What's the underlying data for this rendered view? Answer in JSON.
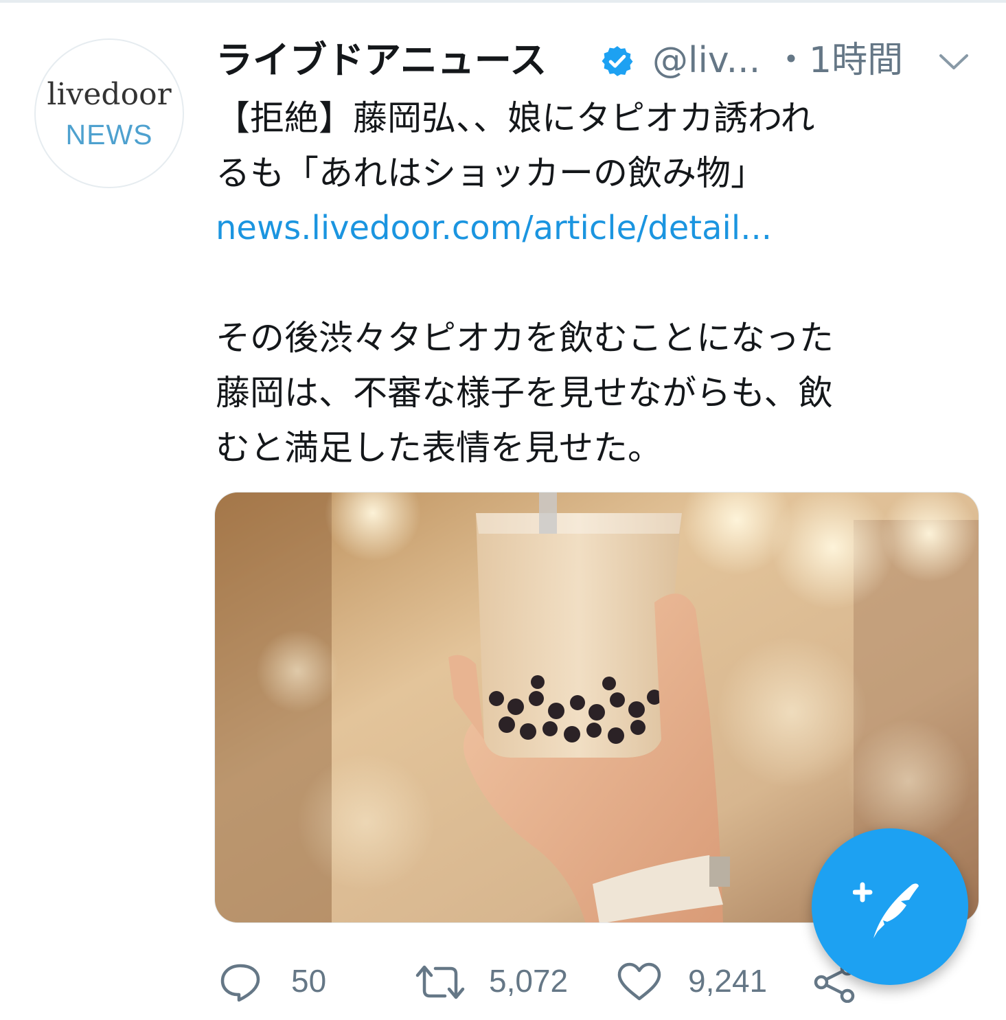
{
  "tweet": {
    "avatar": {
      "brand_top": "livedoor",
      "brand_bottom": "NEWS"
    },
    "display_name": "ライブドアニュース",
    "handle": "@liv...",
    "time": "・1時間",
    "verified": true,
    "lines": [
      "【拒絶】藤岡弘、、娘にタピオカ誘われ",
      "るも「あれはショッカーの飲み物」"
    ],
    "link": "news.livedoor.com/article/detail...",
    "body_lines": [
      "その後渋々タピオカを飲むことになった",
      "藤岡は、不審な様子を見せながらも、飲",
      "むと満足した表情を見せた。"
    ],
    "actions": {
      "reply_count": "50",
      "retweet_count": "5,072",
      "like_count": "9,241"
    }
  },
  "colors": {
    "accent": "#1da1f2",
    "link": "#1b95e0",
    "secondary_text": "#657786"
  },
  "icons": [
    "verified-badge-icon",
    "chevron-down-icon",
    "reply-icon",
    "retweet-icon",
    "like-icon",
    "share-icon",
    "compose-tweet-icon"
  ]
}
